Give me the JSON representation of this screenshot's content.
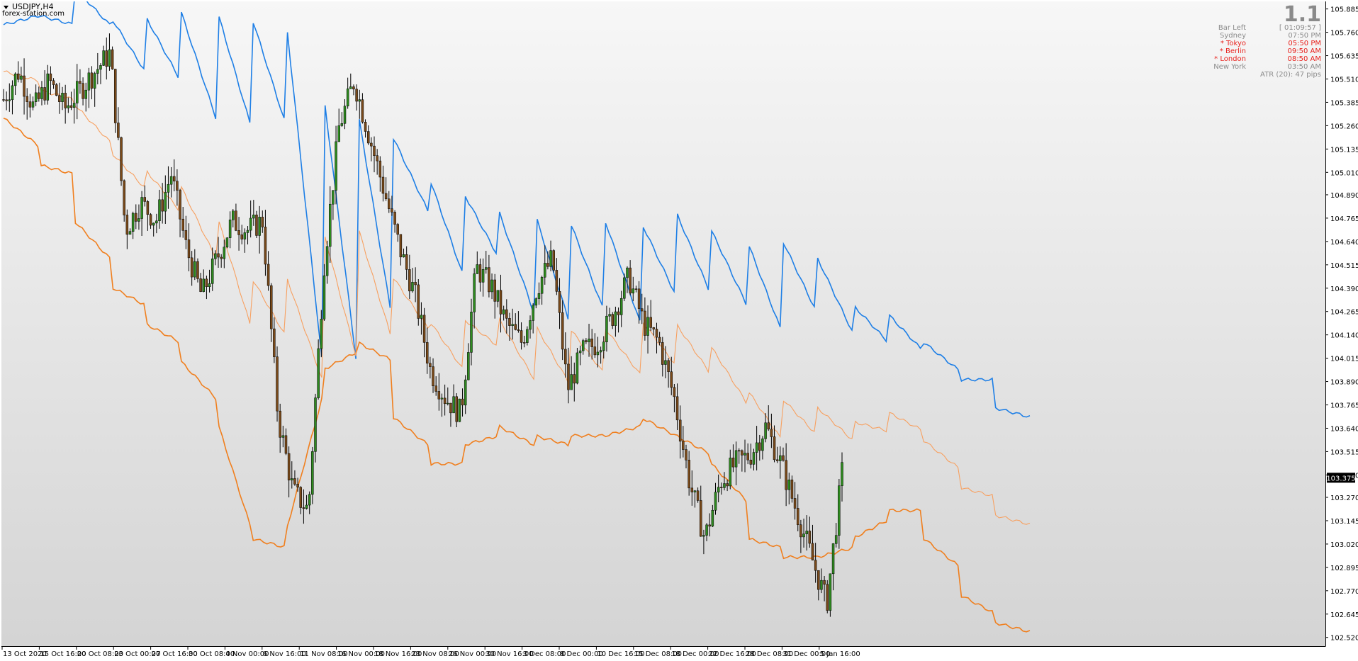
{
  "window": {
    "symbol_label": "USDJPY,H4",
    "watermark": "forex-station.com",
    "menu_icon": "triangle-down-icon"
  },
  "panel": {
    "big_value": "1.1",
    "rows": [
      {
        "label": "Bar Left",
        "value": "[ 01:09:57 ]",
        "highlight": false
      },
      {
        "label": "Sydney",
        "value": "07:50 PM",
        "highlight": false
      },
      {
        "label": "* Tokyo",
        "value": "05:50 PM",
        "highlight": true
      },
      {
        "label": "* Berlin",
        "value": "09:50 AM",
        "highlight": true
      },
      {
        "label": "* London",
        "value": "08:50 AM",
        "highlight": true
      },
      {
        "label": "New York",
        "value": "03:50 AM",
        "highlight": false
      }
    ],
    "atr_text": "ATR (20): 47 pips"
  },
  "colors": {
    "bg_top": "#f7f7f7",
    "bg_bottom": "#d4d4d4",
    "bull": "#2e8b1f",
    "bear": "#7a4a1a",
    "upper_band": "#1e7fe6",
    "lower_band": "#f07f1e",
    "mid_band": "#f7a060",
    "highlight_text": "#e8211c",
    "muted_text": "#8c8c8c",
    "price_tag": "#000000"
  },
  "chart_data": {
    "type": "candlestick",
    "symbol": "USDJPY",
    "timeframe": "H4",
    "current_price": "103.375",
    "ylim": [
      102.5,
      105.895
    ],
    "y_ticks": [
      "105.885",
      "105.760",
      "105.635",
      "105.510",
      "105.385",
      "105.260",
      "105.135",
      "105.010",
      "104.890",
      "104.765",
      "104.640",
      "104.515",
      "104.390",
      "104.265",
      "104.140",
      "104.015",
      "103.890",
      "103.765",
      "103.640",
      "103.515",
      "103.390",
      "103.270",
      "103.145",
      "103.020",
      "102.895",
      "102.770",
      "102.645",
      "102.520"
    ],
    "x_ticks": [
      "13 Oct 2020",
      "15 Oct 16:00",
      "20 Oct 08:00",
      "23 Oct 00:00",
      "27 Oct 16:00",
      "30 Oct 08:00",
      "4 Nov 00:00",
      "6 Nov 16:00",
      "11 Nov 08:00",
      "16 Nov 00:00",
      "18 Nov 16:00",
      "23 Nov 08:00",
      "26 Nov 00:00",
      "30 Nov 16:00",
      "3 Dec 08:00",
      "8 Dec 00:00",
      "10 Dec 16:00",
      "15 Dec 08:00",
      "18 Dec 00:00",
      "22 Dec 16:00",
      "28 Dec 08:00",
      "31 Dec 00:00",
      "5 Jan 16:00"
    ],
    "anchors": [
      105.4,
      105.55,
      105.35,
      105.5,
      105.35,
      105.45,
      105.55,
      105.65,
      104.7,
      104.85,
      104.75,
      105.0,
      104.6,
      104.35,
      104.55,
      104.75,
      104.7,
      104.75,
      103.7,
      103.3,
      103.2,
      104.5,
      105.25,
      105.5,
      105.2,
      104.9,
      104.6,
      104.35,
      103.95,
      103.8,
      103.72,
      104.5,
      104.4,
      104.2,
      104.1,
      104.4,
      104.55,
      103.85,
      104.05,
      104.1,
      104.25,
      104.45,
      104.2,
      104.1,
      103.8,
      103.35,
      103.05,
      103.35,
      103.45,
      103.5,
      103.65,
      103.45,
      103.2,
      102.95,
      102.7,
      103.4
    ],
    "bands": {
      "upper": [
        [
          105.8,
          105.85
        ],
        [
          105.85,
          105.8
        ],
        [
          106.0,
          105.8
        ],
        [
          105.85,
          105.55
        ],
        [
          105.85,
          105.5
        ],
        [
          105.88,
          105.3
        ],
        [
          105.9,
          105.25
        ],
        [
          105.85,
          105.25
        ],
        [
          105.8,
          104.0
        ],
        [
          105.5,
          103.95
        ],
        [
          105.35,
          104.2
        ],
        [
          105.2,
          104.8
        ],
        [
          105.0,
          104.45
        ],
        [
          104.9,
          104.55
        ],
        [
          104.8,
          104.25
        ],
        [
          104.8,
          104.2
        ],
        [
          104.75,
          104.25
        ],
        [
          104.75,
          104.2
        ],
        [
          104.75,
          104.35
        ],
        [
          104.8,
          104.35
        ],
        [
          104.7,
          104.3
        ],
        [
          104.65,
          104.15
        ],
        [
          104.65,
          104.25
        ],
        [
          104.55,
          104.15
        ],
        [
          104.3,
          104.1
        ],
        [
          104.25,
          104.05
        ],
        [
          104.1,
          103.95
        ],
        [
          103.9,
          103.9
        ],
        [
          103.75,
          103.7
        ]
      ],
      "lower": [
        [
          105.3,
          105.15
        ],
        [
          105.05,
          105.0
        ],
        [
          104.75,
          104.55
        ],
        [
          104.4,
          104.3
        ],
        [
          104.2,
          104.1
        ],
        [
          104.0,
          103.8
        ],
        [
          103.7,
          103.1
        ],
        [
          103.05,
          103.0
        ],
        [
          103.1,
          103.8
        ],
        [
          103.95,
          104.05
        ],
        [
          104.1,
          104.0
        ],
        [
          103.7,
          103.55
        ],
        [
          103.45,
          103.45
        ],
        [
          103.55,
          103.6
        ],
        [
          103.65,
          103.55
        ],
        [
          103.6,
          103.55
        ],
        [
          103.6,
          103.6
        ],
        [
          103.6,
          103.65
        ],
        [
          103.7,
          103.6
        ],
        [
          103.6,
          103.5
        ],
        [
          103.45,
          103.25
        ],
        [
          103.05,
          103.0
        ],
        [
          102.95,
          102.95
        ],
        [
          102.95,
          103.0
        ],
        [
          103.05,
          103.15
        ],
        [
          103.2,
          103.2
        ],
        [
          103.05,
          102.9
        ],
        [
          102.75,
          102.65
        ],
        [
          102.6,
          102.55
        ]
      ]
    }
  }
}
